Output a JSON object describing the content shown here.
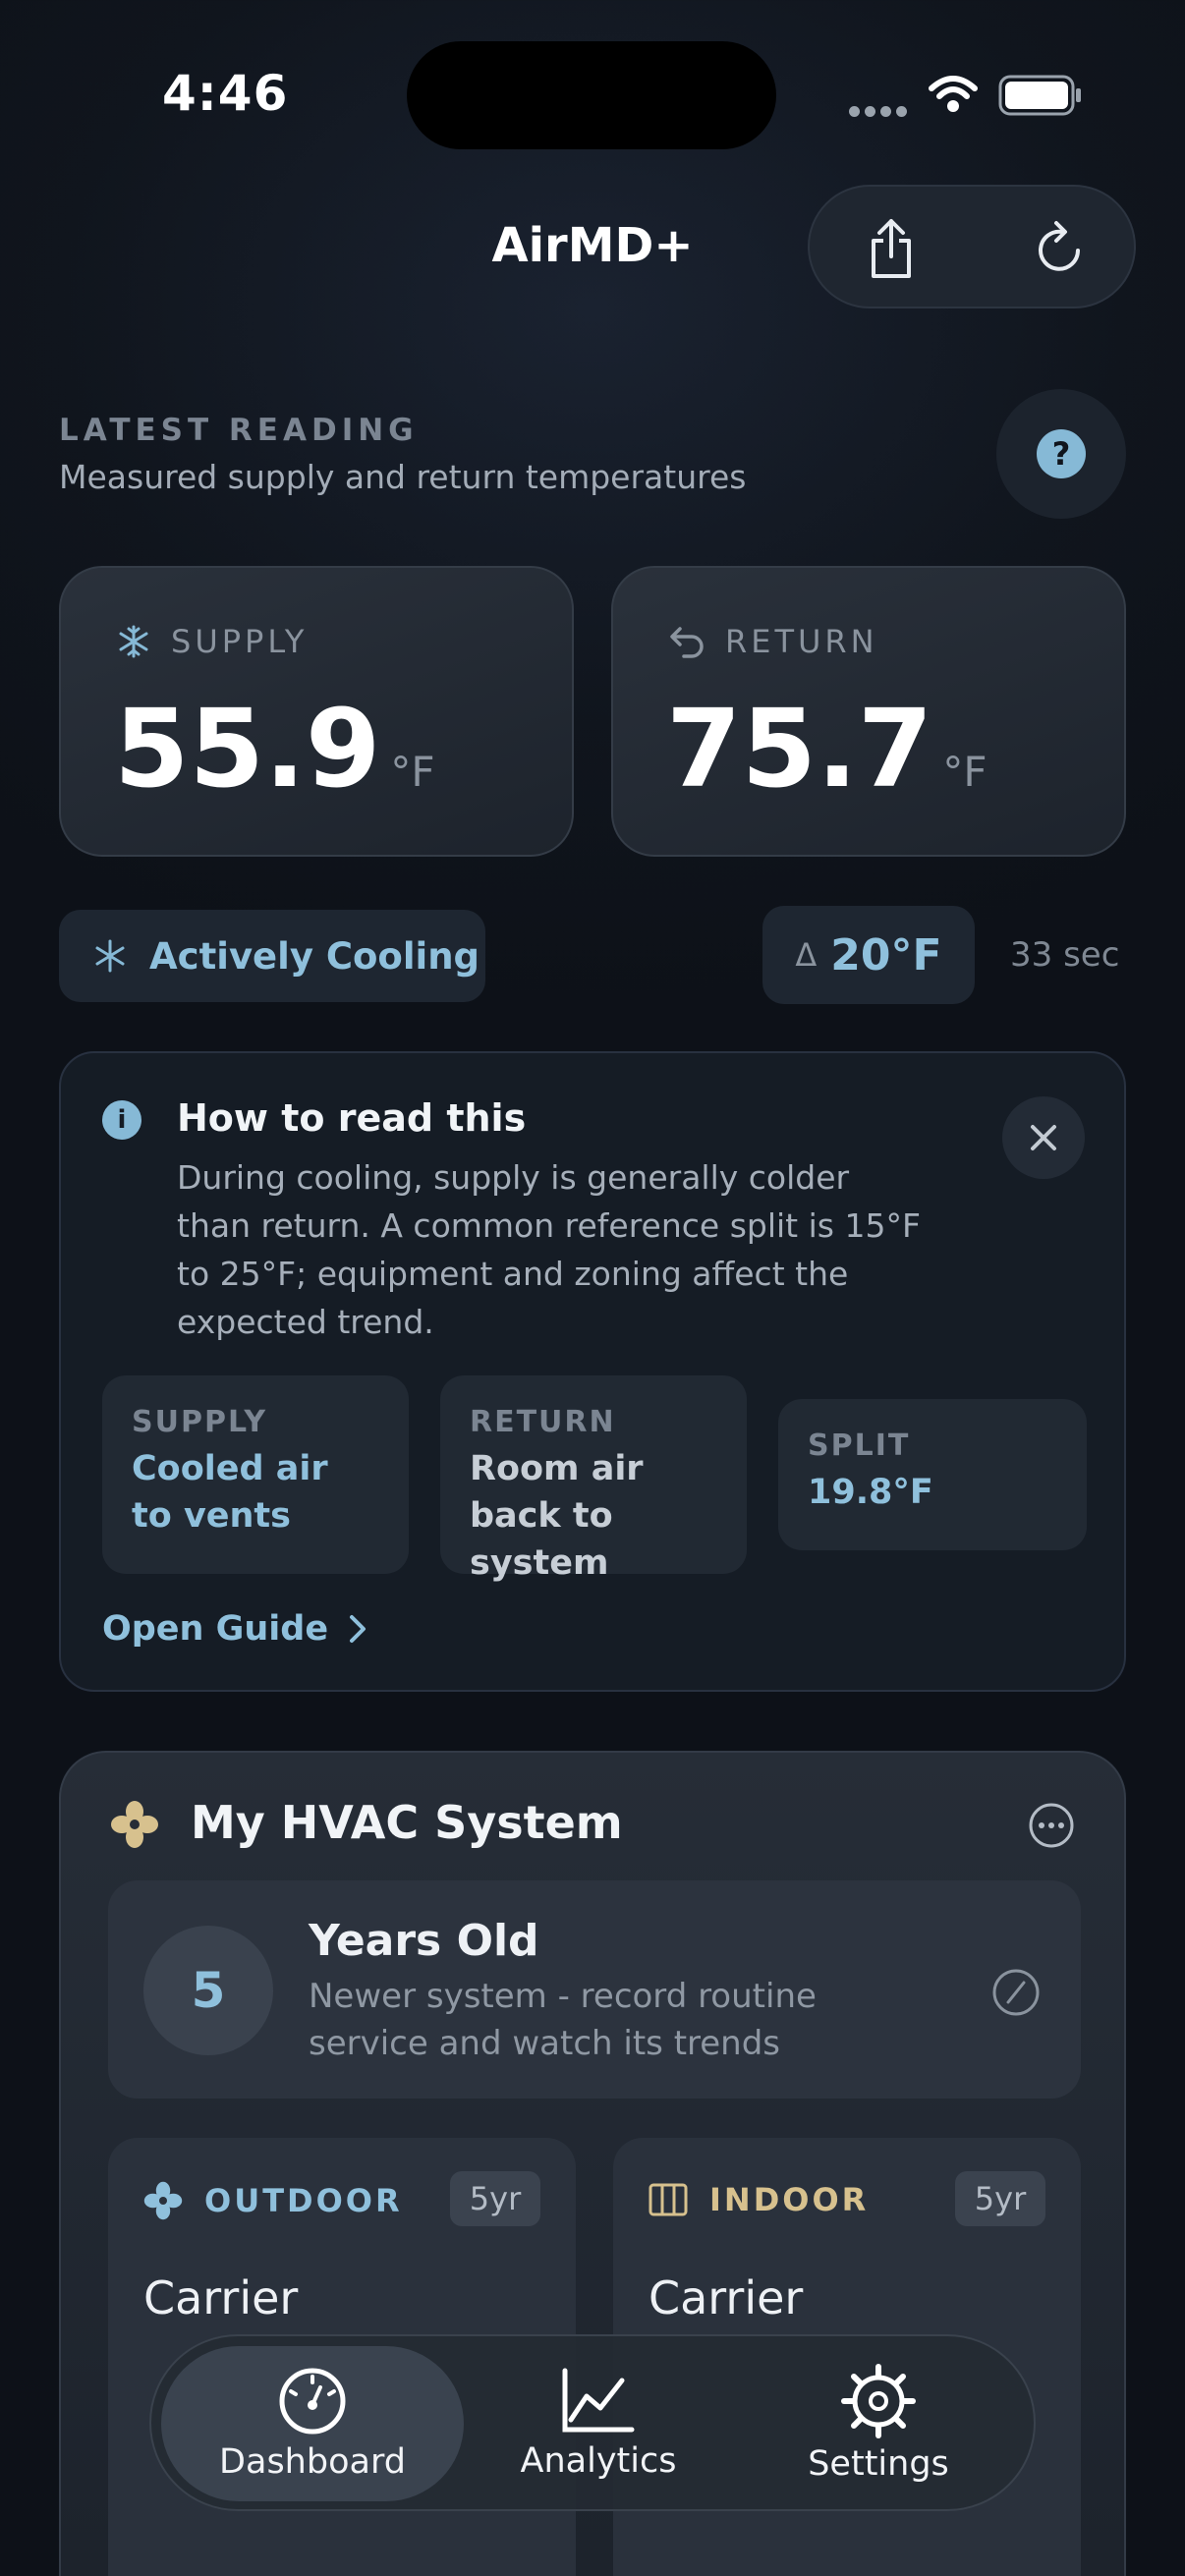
{
  "status_bar": {
    "time": "4:46"
  },
  "header": {
    "title": "AirMD+",
    "share_icon": "share-icon",
    "refresh_icon": "refresh-icon"
  },
  "latest": {
    "label": "LATEST READING",
    "subtitle": "Measured supply and return temperatures",
    "help": "?"
  },
  "supply": {
    "label": "SUPPLY",
    "value": "55.9",
    "unit": "°F"
  },
  "return": {
    "label": "RETURN",
    "value": "75.7",
    "unit": "°F"
  },
  "status": {
    "mode": "Actively Cooling",
    "delta_symbol": "Δ",
    "delta": "20°F",
    "elapsed": "33 sec"
  },
  "info": {
    "icon": "i",
    "title": "How to read this",
    "body": "During cooling, supply is generally colder than return. A common reference split is 15°F to 25°F; equipment and zoning affect the expected trend.",
    "supply_key": "SUPPLY",
    "supply_val": "Cooled air to vents",
    "return_key": "RETURN",
    "return_val": "Room air back to system",
    "split_key": "SPLIT",
    "split_val": "19.8°F",
    "guide": "Open Guide"
  },
  "hvac": {
    "title": "My HVAC System",
    "age_number": "5",
    "age_title": "Years Old",
    "age_sub": "Newer system - record routine service and watch its trends",
    "outdoor": {
      "tag": "OUTDOOR",
      "years": "5yr",
      "brand": "Carrier"
    },
    "indoor": {
      "tag": "INDOOR",
      "years": "5yr",
      "brand": "Carrier"
    }
  },
  "tabs": [
    {
      "label": "Dashboard",
      "icon": "gauge-icon"
    },
    {
      "label": "Analytics",
      "icon": "chart-icon"
    },
    {
      "label": "Settings",
      "icon": "gear-icon"
    }
  ],
  "colors": {
    "accent": "#8fc0dc",
    "indoor_accent": "#d7c18e",
    "background": "#10151d"
  }
}
